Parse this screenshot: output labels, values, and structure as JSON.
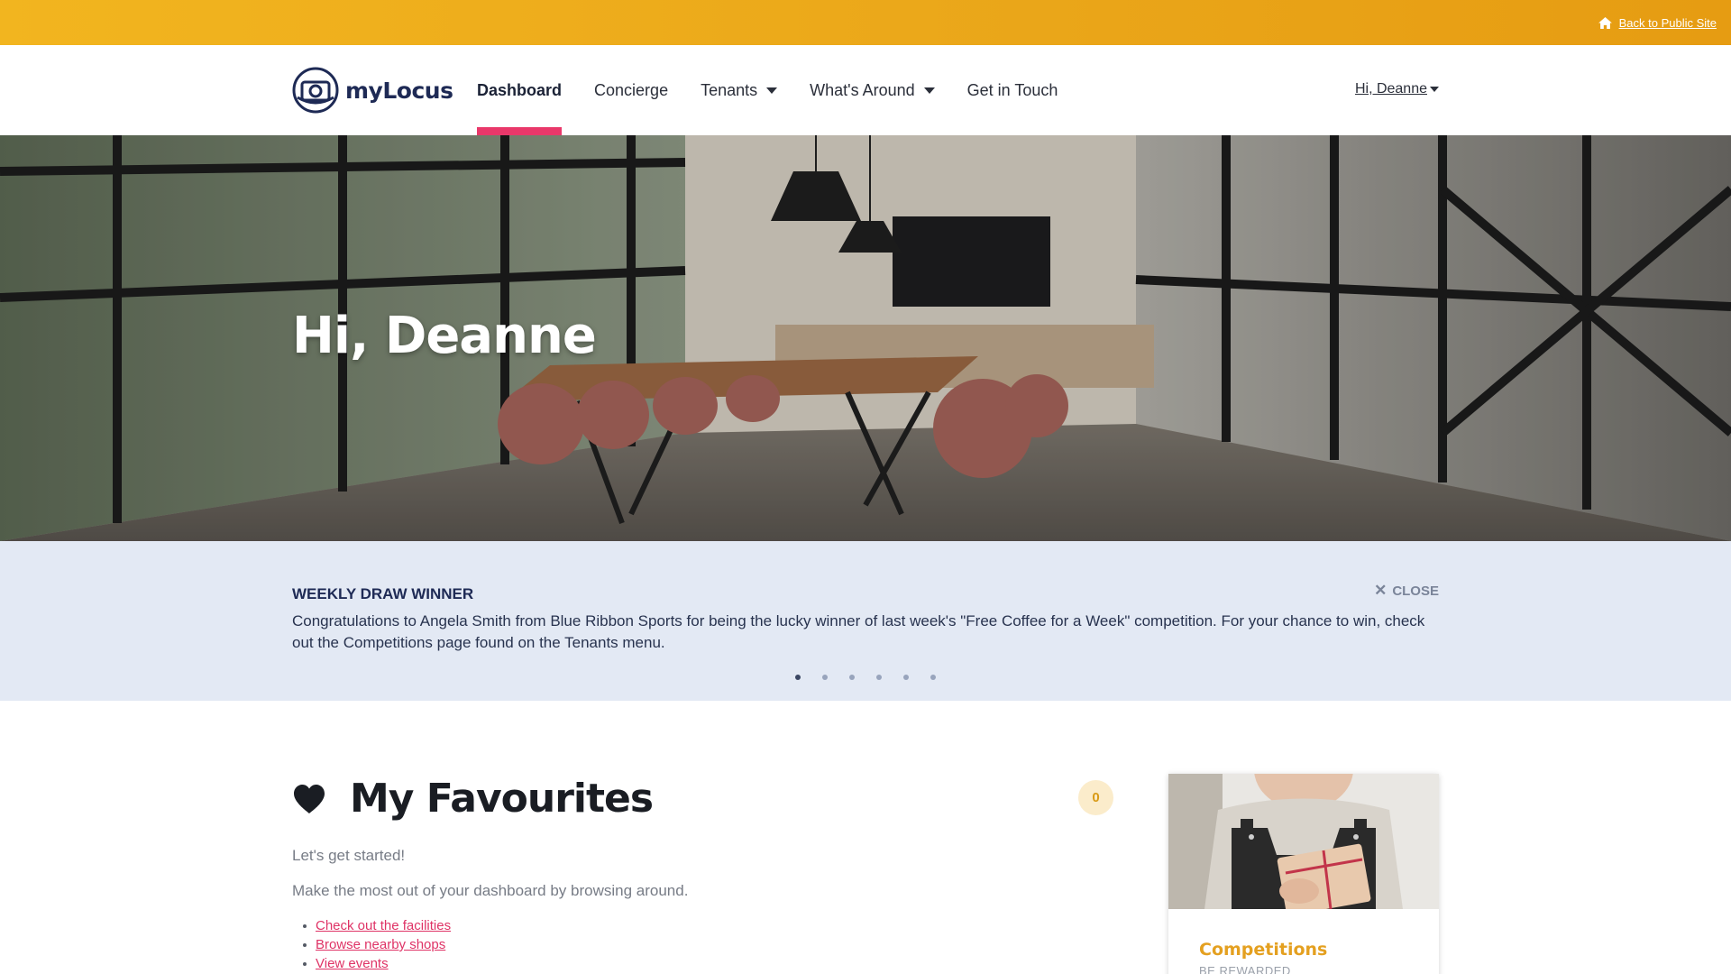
{
  "top_bar": {
    "back_link": "Back to Public Site",
    "icon": "home-icon"
  },
  "navbar": {
    "logo_text": "myLocus",
    "items": [
      {
        "label": "Dashboard",
        "active": true,
        "dropdown": false
      },
      {
        "label": "Concierge",
        "active": false,
        "dropdown": false
      },
      {
        "label": "Tenants",
        "active": false,
        "dropdown": true
      },
      {
        "label": "What's Around",
        "active": false,
        "dropdown": true
      },
      {
        "label": "Get in Touch",
        "active": false,
        "dropdown": false
      }
    ],
    "user_menu": "Hi, Deanne"
  },
  "hero": {
    "title": "Hi, Deanne"
  },
  "announcement": {
    "title": "WEEKLY DRAW WINNER",
    "close_label": "CLOSE",
    "body": "Congratulations to Angela Smith from Blue Ribbon Sports for being the lucky winner of last week's \"Free Coffee for a Week\" competition. For your chance to win, check out the Competitions page found on the Tenants menu.",
    "slide_count": 6,
    "active_slide": 1
  },
  "favourites": {
    "title": "My Favourites",
    "count": "0",
    "intro": "Let's get started!",
    "hint": "Make the most out of your dashboard by browsing around.",
    "links": [
      "Check out the facilities",
      "Browse nearby shops",
      "View events"
    ]
  },
  "card": {
    "title": "Competitions",
    "subtitle": "BE REWARDED"
  },
  "colors": {
    "gold": "#eaa619",
    "accent_pink": "#e9386a",
    "navy": "#1e2a55",
    "banner_bg": "#e3e9f4"
  }
}
